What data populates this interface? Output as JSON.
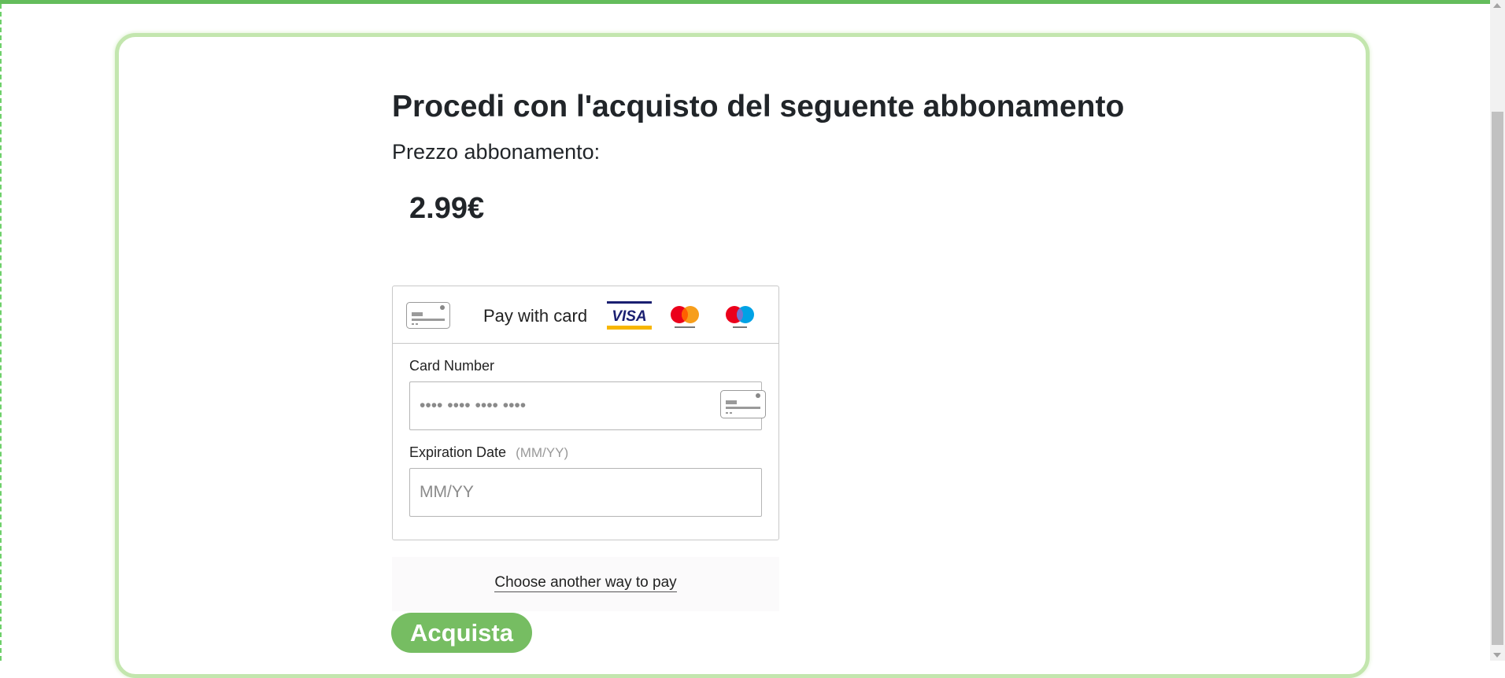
{
  "page": {
    "title": "Procedi con l'acquisto del seguente abbonamento",
    "price_label": "Prezzo abbonamento:",
    "price_value": "2.99€"
  },
  "payment": {
    "header_title": "Pay with card",
    "brands": [
      "visa-icon",
      "mastercard-icon",
      "maestro-icon"
    ],
    "visa_text": "VISA",
    "card_number": {
      "label": "Card Number",
      "placeholder": "•••• •••• •••• ••••",
      "value": ""
    },
    "expiration": {
      "label": "Expiration Date",
      "hint": "(MM/YY)",
      "placeholder": "MM/YY",
      "value": ""
    },
    "alternate_link": "Choose another way to pay"
  },
  "actions": {
    "buy_label": "Acquista"
  },
  "colors": {
    "accent_green": "#76bd62",
    "card_border": "#c3e6ae",
    "top_bar": "#64bd5c",
    "visa_blue": "#1a1f71",
    "visa_gold": "#f7b600",
    "mastercard_red": "#eb001b",
    "mastercard_orange": "#f79e1b",
    "maestro_blue": "#00a2e5"
  }
}
